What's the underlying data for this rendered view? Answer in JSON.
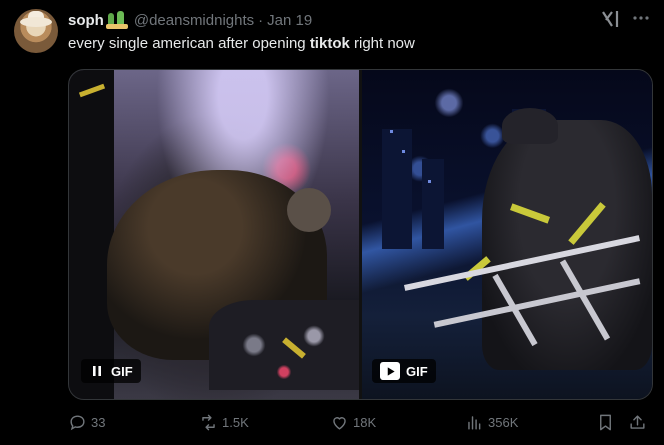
{
  "tweet": {
    "display_name": "soph",
    "handle": "@deansmidnights",
    "separator": "·",
    "date": "Jan 19",
    "text_before": "every single american after opening ",
    "text_bold": "tiktok",
    "text_after": " right now"
  },
  "media": {
    "gif_left": {
      "label": "GIF",
      "control_icon": "pause-icon"
    },
    "gif_right": {
      "label": "GIF",
      "control_icon": "play-icon"
    }
  },
  "actions": {
    "replies": "33",
    "reposts": "1.5K",
    "likes": "18K",
    "views": "356K"
  },
  "icons": [
    "grok-icon",
    "more-icon",
    "reply-icon",
    "repost-icon",
    "like-icon",
    "views-icon",
    "bookmark-icon",
    "share-icon",
    "cactus-emoji-icon"
  ],
  "colors": {
    "background": "#000000",
    "text": "#e7e9ea",
    "muted": "#71767b",
    "border": "#333639"
  }
}
